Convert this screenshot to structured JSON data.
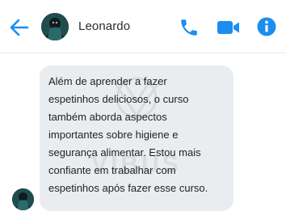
{
  "header": {
    "contact_name": "Leonardo",
    "icons": {
      "back": "arrow-left-icon",
      "call": "phone-icon",
      "video": "video-camera-icon",
      "info": "info-icon"
    },
    "accent_color": "#1a8ef0"
  },
  "messages": [
    {
      "sender": "Leonardo",
      "text": "Além de aprender a fazer\nespetinhos deliciosos, o curso\ntambém aborda aspectos\nimportantes sobre higiene e\nsegurança alimentar. Estou mais\nconfiante em trabalhar com\nespetinhos após fazer esse curso."
    }
  ],
  "watermark": {
    "text": "VIBUS"
  }
}
